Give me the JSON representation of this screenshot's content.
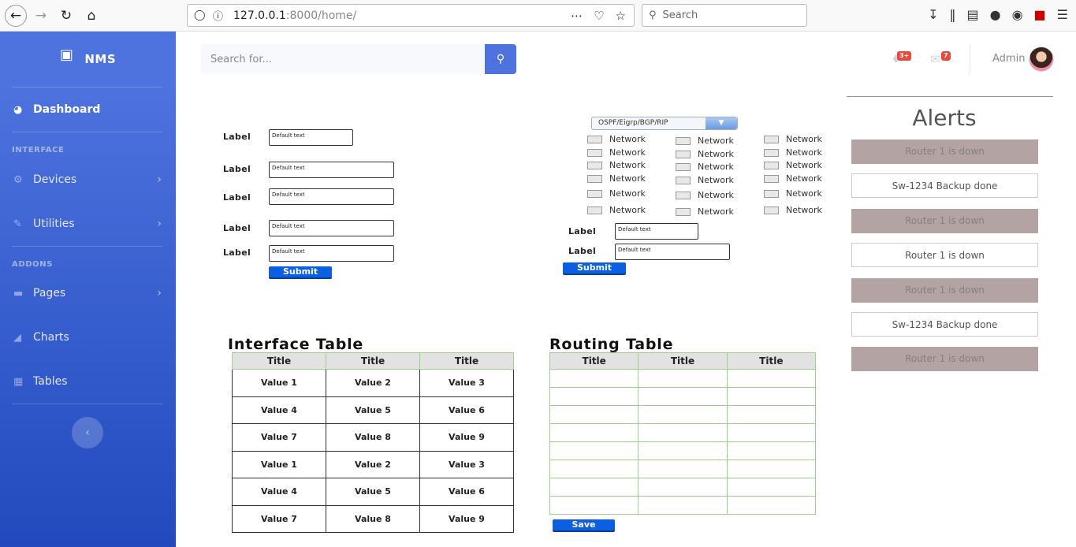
{
  "browser": {
    "url_host": "127.0.0.1",
    "url_rest": ":8000/home/",
    "search_placeholder": "Search"
  },
  "sidebar": {
    "brand": "NMS",
    "dashboard": "Dashboard",
    "heading_interface": "INTERFACE",
    "devices": "Devices",
    "utilities": "Utilities",
    "heading_addons": "ADDONS",
    "pages": "Pages",
    "charts": "Charts",
    "tables": "Tables"
  },
  "topbar": {
    "search_placeholder": "Search for...",
    "alerts_badge": "3+",
    "messages_badge": "7",
    "user_name": "Admin"
  },
  "form_left": {
    "label": "Label",
    "default_text": "Default text",
    "submit": "Submit"
  },
  "form_right": {
    "dropdown_value": "OSPF/Eigrp/BGP/RIP",
    "checkbox_label": "Network",
    "label": "Label",
    "default_text": "Default text",
    "submit": "Submit"
  },
  "interface_table": {
    "title": "Interface Table",
    "headers": [
      "Title",
      "Title",
      "Title"
    ],
    "rows": [
      [
        "Value 1",
        "Value 2",
        "Value 3"
      ],
      [
        "Value 4",
        "Value 5",
        "Value 6"
      ],
      [
        "Value 7",
        "Value 8",
        "Value 9"
      ],
      [
        "Value 1",
        "Value 2",
        "Value 3"
      ],
      [
        "Value 4",
        "Value 5",
        "Value 6"
      ],
      [
        "Value 7",
        "Value 8",
        "Value 9"
      ]
    ]
  },
  "routing_table": {
    "title": "Routing Table",
    "headers": [
      "Title",
      "Title",
      "Title"
    ],
    "save": "Save"
  },
  "alerts": {
    "title": "Alerts",
    "items": [
      {
        "text": "Router 1 is down",
        "style": "dark"
      },
      {
        "text": "Sw-1234 Backup done",
        "style": "light"
      },
      {
        "text": "Router 1 is down",
        "style": "dark"
      },
      {
        "text": "Router 1 is down",
        "style": "light"
      },
      {
        "text": "Router 1 is down",
        "style": "dark"
      },
      {
        "text": "Sw-1234 Backup done",
        "style": "light"
      },
      {
        "text": "Router 1 is down",
        "style": "dark"
      }
    ]
  },
  "colors": {
    "sidebar_top": "#4e73df",
    "sidebar_bottom": "#224abe",
    "alert_dark": "#b3a3a3",
    "button_blue": "#0b5fe0"
  }
}
